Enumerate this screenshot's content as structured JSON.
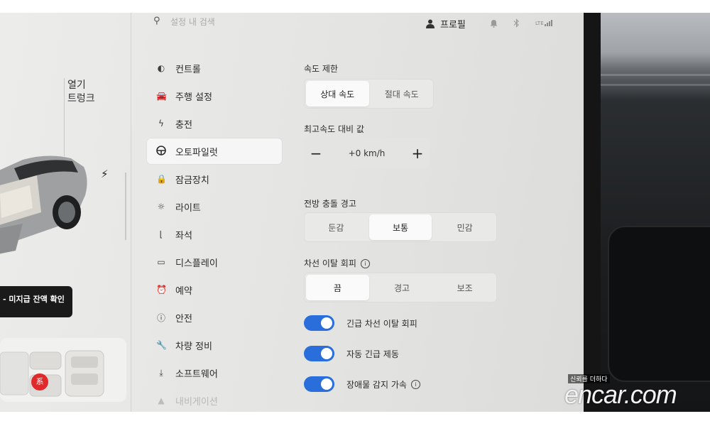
{
  "search": {
    "placeholder": "설정 내 검색"
  },
  "header": {
    "profile_label": "프로필",
    "lte_label": "LTE"
  },
  "car_panel": {
    "open_label": "열기",
    "trunk_label": "트렁크",
    "toast_text": "- 미지급 잔액 확인",
    "seat_alert": "系"
  },
  "menu": {
    "items": [
      {
        "label": "컨트롤",
        "icon": "toggle-icon"
      },
      {
        "label": "주행 설정",
        "icon": "car-icon"
      },
      {
        "label": "충전",
        "icon": "lightning-icon"
      },
      {
        "label": "오토파일럿",
        "icon": "steering-wheel-icon",
        "active": true
      },
      {
        "label": "잠금장치",
        "icon": "lock-icon"
      },
      {
        "label": "라이트",
        "icon": "light-icon"
      },
      {
        "label": "좌석",
        "icon": "seat-icon"
      },
      {
        "label": "디스플레이",
        "icon": "display-icon"
      },
      {
        "label": "예약",
        "icon": "alarm-clock-icon"
      },
      {
        "label": "안전",
        "icon": "alert-circle-icon"
      },
      {
        "label": "차량 정비",
        "icon": "wrench-icon"
      },
      {
        "label": "소프트웨어",
        "icon": "download-icon"
      },
      {
        "label": "내비게이션",
        "icon": "navigation-icon"
      }
    ]
  },
  "speed_limit": {
    "title": "속도 제한",
    "options": [
      "상대 속도",
      "절대 속도"
    ],
    "selected": "상대 속도"
  },
  "speed_offset": {
    "title": "최고속도 대비 값",
    "value": "+0 km/h",
    "minus": "−",
    "plus": "+"
  },
  "forward_collision": {
    "title": "전방 충돌 경고",
    "options": [
      "둔감",
      "보통",
      "민감"
    ],
    "selected": "보통"
  },
  "lane_departure": {
    "title": "차선 이탈 회피",
    "info": "i",
    "options": [
      "끔",
      "경고",
      "보조"
    ],
    "selected": "끔"
  },
  "toggles": [
    {
      "label": "긴급 차선 이탈 회피",
      "on": true
    },
    {
      "label": "자동 긴급 제동",
      "on": true
    },
    {
      "label": "장애물 감지 가속",
      "on": true,
      "info": "i"
    }
  ],
  "watermark": {
    "tagline": "신뢰를 더하다",
    "logo": "encar.com"
  },
  "colors": {
    "accent": "#2a6edc",
    "toast_bg": "#1a1a1a",
    "alert": "#e02a2a"
  }
}
